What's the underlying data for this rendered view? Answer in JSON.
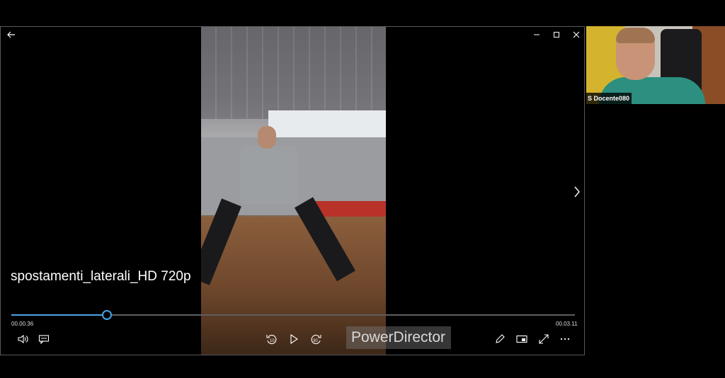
{
  "player": {
    "title": "spostamenti_laterali_HD 720p",
    "elapsed": "00.00.36",
    "total": "00.03.11",
    "progress_fraction": 0.168,
    "watermark": "PowerDirector",
    "accent_color": "#4aa3e8"
  },
  "icons": {
    "back": "back-arrow-icon",
    "minimize": "minimize-icon",
    "maximize": "maximize-icon",
    "close": "close-icon",
    "next": "chevron-right-icon",
    "volume": "volume-icon",
    "subtitles": "subtitles-icon",
    "rewind": "rewind-10-icon",
    "rewind_label": "10",
    "play": "play-icon",
    "forward": "forward-30-icon",
    "forward_label": "30",
    "edit": "pencil-icon",
    "mini_view": "mini-view-icon",
    "fullscreen": "fullscreen-icon",
    "more": "more-icon"
  },
  "participant": {
    "name": "S  Docente080"
  }
}
